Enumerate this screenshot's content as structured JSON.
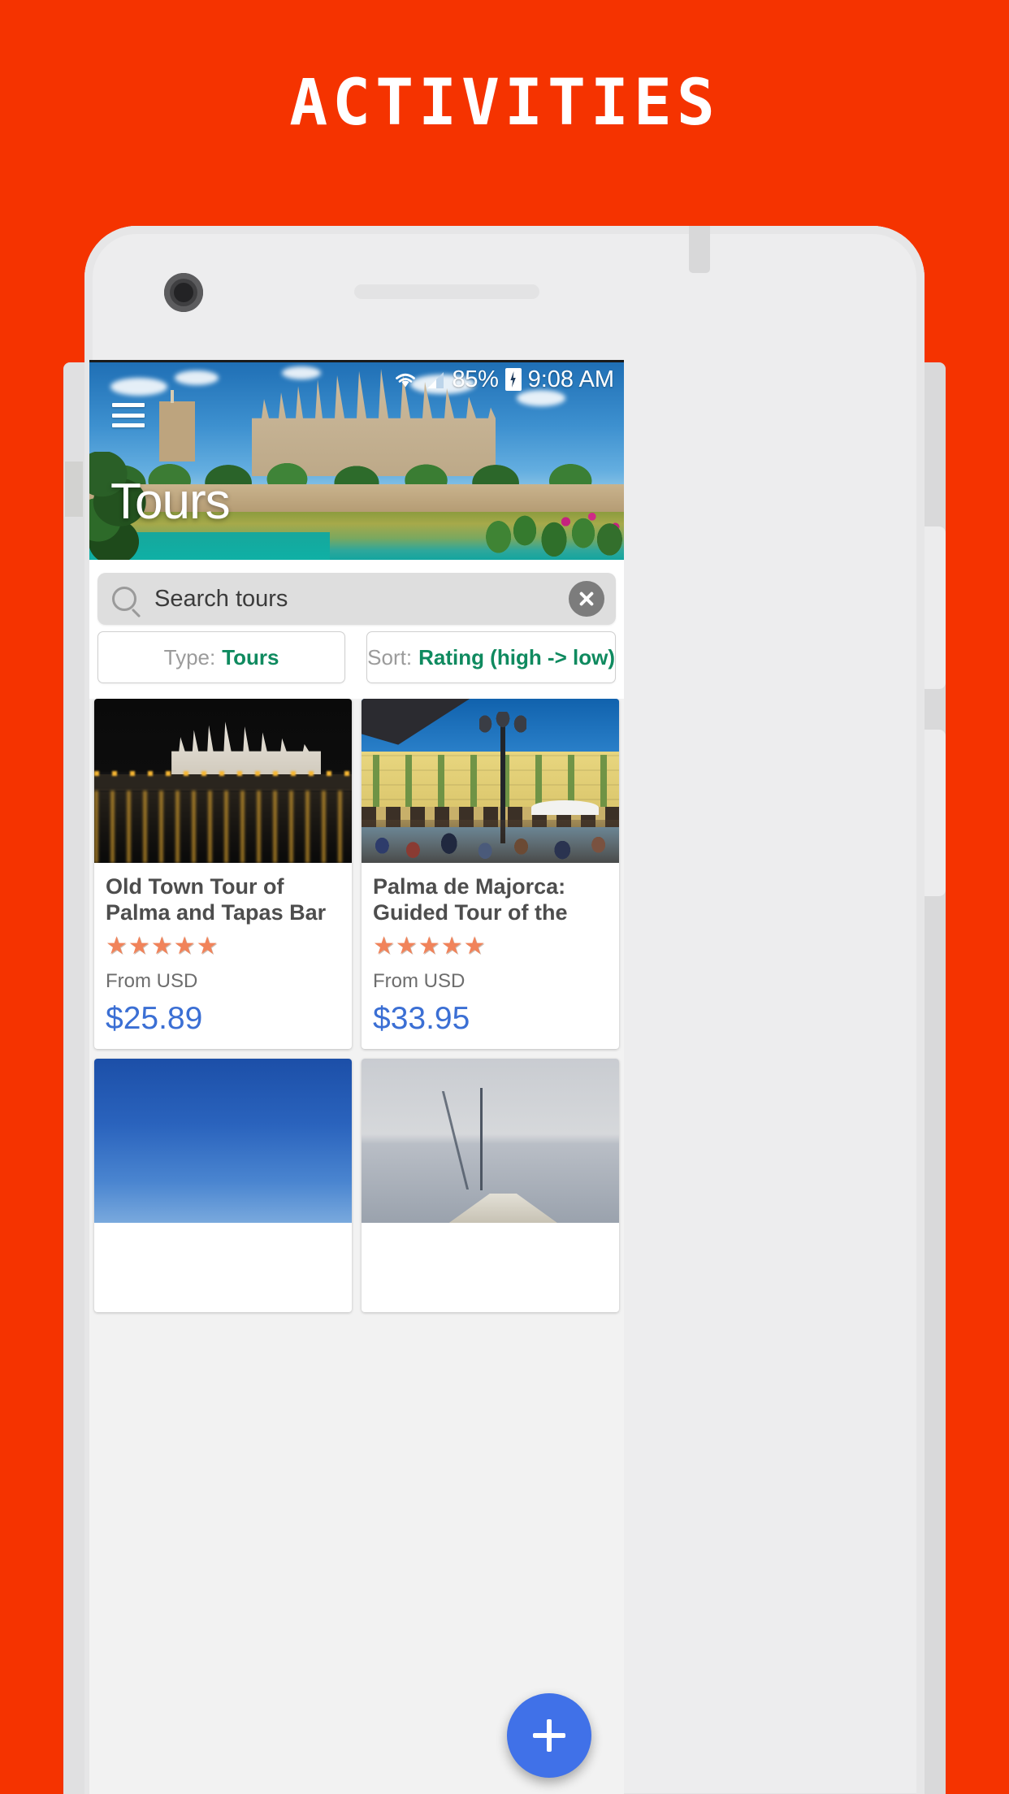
{
  "banner": {
    "title": "ACTIVITIES",
    "background_color": "#f53300"
  },
  "device": {
    "frame_color": "#ededee",
    "camera_icon": "camera-icon",
    "speaker_icon": "speaker-grille-icon",
    "home_pill_icon": "home-pill-icon"
  },
  "status_bar": {
    "wifi_icon": "wifi-icon",
    "signal_icon": "signal-bars-icon",
    "battery_percent": "85%",
    "battery_icon": "battery-charging-icon",
    "time": "9:08 AM"
  },
  "hero": {
    "menu_icon": "hamburger-menu-icon",
    "title": "Tours"
  },
  "search": {
    "icon": "search-icon",
    "placeholder": "Search tours",
    "value": "Search tours",
    "clear_icon": "close-circle-icon"
  },
  "filters": [
    {
      "label": "Type:",
      "value": "Tours",
      "name": "filter-type"
    },
    {
      "label": "Sort:",
      "value": "Rating (high -> low)",
      "name": "filter-sort"
    }
  ],
  "colors": {
    "accent_green": "#0f8a5f",
    "price_blue": "#3b6fd4",
    "star_orange": "#f1835a",
    "fab_blue": "#4071e8"
  },
  "cards": [
    {
      "title": "Old Town Tour of Palma and Tapas Bar by Night",
      "stars": "★★★★★",
      "rating": 5,
      "from_label": "From USD",
      "price": "$25.89",
      "image": "palma-cathedral-night-reflection"
    },
    {
      "title": "Palma de Majorca: Guided Tour of the Ol…",
      "stars": "★★★★★",
      "rating": 5,
      "from_label": "From USD",
      "price": "$33.95",
      "image": "plaza-major-cafes-lamppost"
    },
    {
      "title": "",
      "stars": "",
      "rating": 0,
      "from_label": "",
      "price": "",
      "image": "blue-sky"
    },
    {
      "title": "",
      "stars": "",
      "rating": 0,
      "from_label": "",
      "price": "",
      "image": "sailing-boat-sea"
    }
  ],
  "fab": {
    "icon": "plus-icon",
    "label": "+"
  }
}
